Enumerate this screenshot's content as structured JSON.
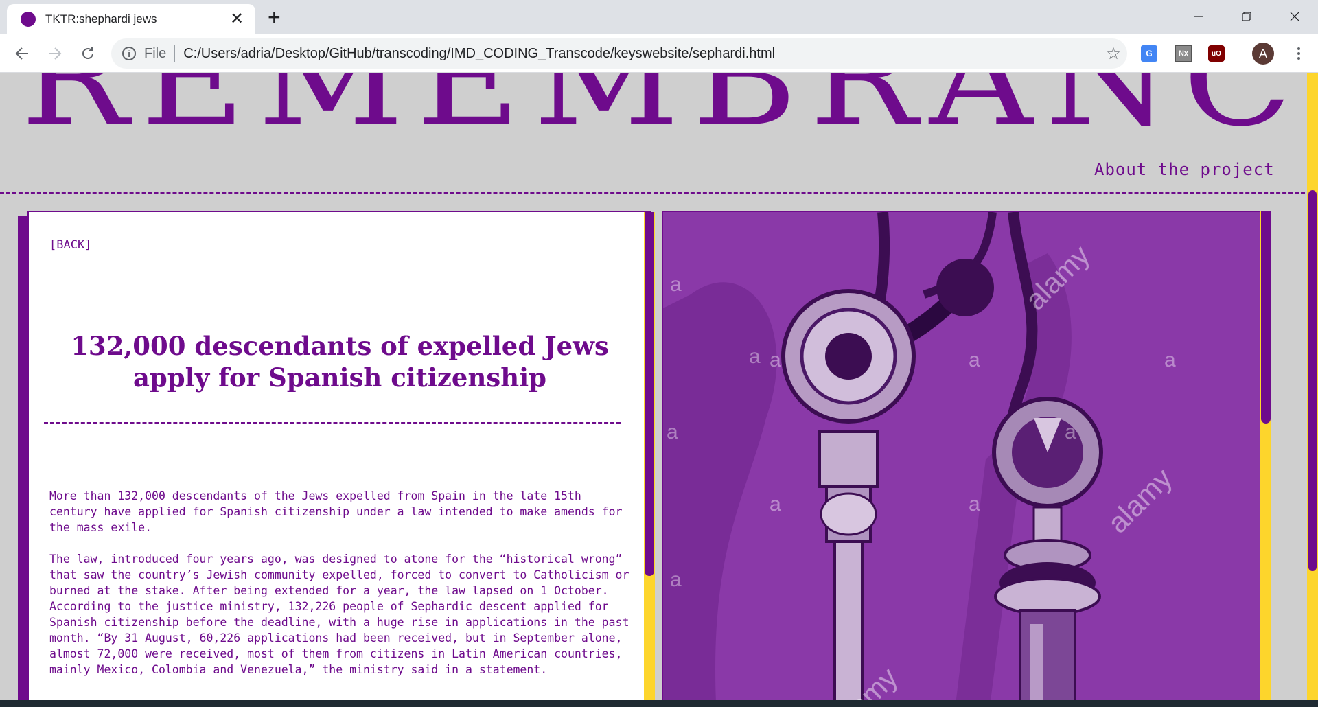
{
  "browser": {
    "tab_title": "TKTR:shephardi jews",
    "new_tab": "+",
    "file_label": "File",
    "url": "C:/Users/adria/Desktop/GitHub/transcoding/IMD_CODING_Transcode/keyswebsite/sephardi.html",
    "profile_initial": "A",
    "extensions": [
      "translate-icon",
      "nx-icon",
      "ublock-icon"
    ],
    "ext_nx_label": "Nx",
    "ext_ublock_label": "uO"
  },
  "site": {
    "title": "REMEMBRANCE",
    "about_link": "About the project"
  },
  "article": {
    "back_link": "[BACK]",
    "headline": "132,000 descendants of expelled Jews apply for Spanish citizenship",
    "paragraphs": [
      "More than 132,000 descendants of the Jews expelled from Spain in the late 15th century have applied for Spanish citizenship under a law intended to make amends for the mass exile.",
      "The law, introduced four years ago, was designed to atone for the “historical wrong” that saw the country’s Jewish community expelled, forced to convert to Catholicism or burned at the stake. After being extended for a year, the law lapsed on 1 October. According to the justice ministry, 132,226 people of Sephardic descent applied for Spanish citizenship before the deadline, with a huge rise in applications in the past month. “By 31 August, 60,226 applications had been received, but in September alone, almost 72,000 were received, most of them from citizens in Latin American countries, mainly Mexico, Colombia and Venezuela,” the ministry said in a statement."
    ]
  },
  "image": {
    "watermark_brand": "alamy",
    "watermark_letter": "a"
  },
  "colors": {
    "accent": "#6e0b8c",
    "page_bg": "#cfcfcf",
    "scroll_track": "#fdd52c",
    "image_tint": "#8a39a8"
  }
}
